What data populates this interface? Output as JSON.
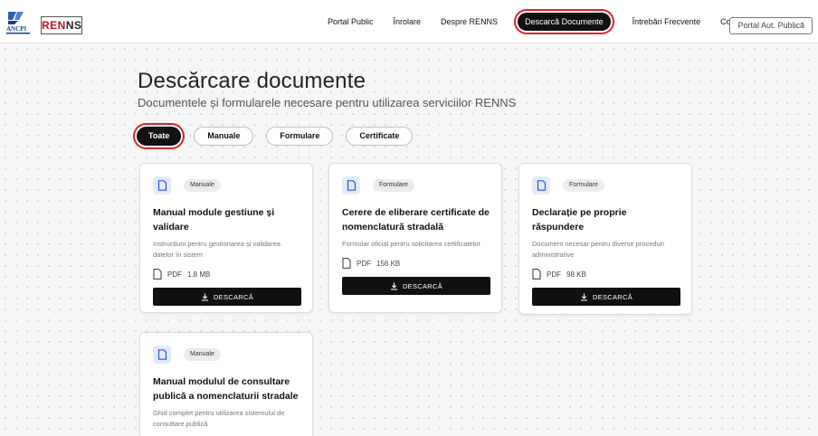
{
  "header": {
    "logo_ancpi": "ANCPI",
    "logo_renns_red": "REN",
    "logo_renns_dark": "NS",
    "nav": [
      {
        "label": "Portal Public"
      },
      {
        "label": "Înrolare"
      },
      {
        "label": "Despre RENNS"
      },
      {
        "label": "Descarcă Documente"
      },
      {
        "label": "Întrebări Frecvente"
      },
      {
        "label": "Contact"
      }
    ],
    "cta_label": "Portal Aut. Publică",
    "active_nav": "Descarcă Documente",
    "accent_color": "#d8252b"
  },
  "page": {
    "title": "Descărcare documente",
    "subtitle": "Documentele și formularele necesare pentru utilizarea serviciilor RENNS"
  },
  "filters": [
    {
      "label": "Toate",
      "active": true
    },
    {
      "label": "Manuale",
      "active": false
    },
    {
      "label": "Formulare",
      "active": false
    },
    {
      "label": "Certificate",
      "active": false
    }
  ],
  "cards": [
    {
      "category": "Manuale",
      "title": "Manual module gestiune și validare",
      "description": "Instrucțiuni pentru gestionarea și validarea datelor în sistem",
      "file_type": "PDF",
      "file_size": "1.8 MB",
      "button_label": "DESCARCĂ"
    },
    {
      "category": "Formulare",
      "title": "Cerere de eliberare certificate de nomenclatură stradală",
      "description": "Formular oficial pentru solicitarea certificatelor",
      "file_type": "PDF",
      "file_size": "156 KB",
      "button_label": "DESCARCĂ"
    },
    {
      "category": "Formulare",
      "title": "Declarație pe proprie răspundere",
      "description": "Document necesar pentru diverse proceduri administrative",
      "file_type": "PDF",
      "file_size": "98 KB",
      "button_label": "DESCARCĂ"
    },
    {
      "category": "Manuale",
      "title": "Manual modulul de consultare publică a nomenclaturii stradale",
      "description": "Ghid complet pentru utilizarea sistemului de consultare publică"
    }
  ],
  "icons": {
    "doc_card": "document-icon",
    "file_meta": "file-icon",
    "download": "download-icon"
  }
}
